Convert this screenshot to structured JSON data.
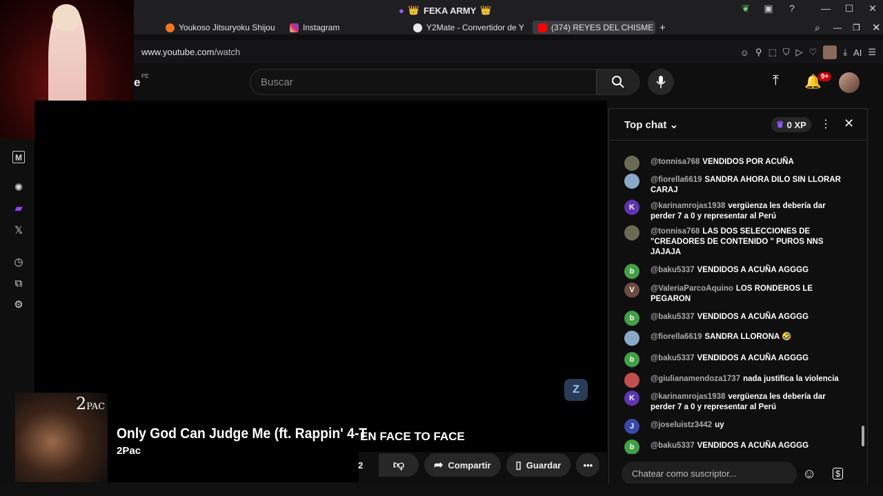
{
  "window": {
    "title": "FEKA ARMY",
    "title_prefix_icon": "crown-emoji",
    "controls": [
      "—",
      "☐",
      "✕"
    ]
  },
  "tabs": [
    {
      "label": "Youkoso Jitsuryoku Shijou",
      "favicon": "crunchyroll-icon",
      "color": "#f47521"
    },
    {
      "label": "Instagram",
      "favicon": "instagram-icon",
      "color": "#d6249f"
    },
    {
      "label": "Y2Mate - Convertidor de Y",
      "favicon": "y2mate-icon",
      "color": "#e8e8e8"
    },
    {
      "label": "(374) REYES DEL CHISME",
      "favicon": "youtube-icon",
      "color": "#ff0000",
      "active": true
    }
  ],
  "address": {
    "url_host": "www.youtube.com",
    "url_path": "/watch",
    "ai_label": "AI"
  },
  "youtube_header": {
    "logo_suffix": "PE",
    "logo_letter": "e",
    "search_placeholder": "Buscar",
    "notifications_badge": "9+"
  },
  "video": {
    "overlay_text": "EN FACE TO FACE",
    "watermark_text": "Z"
  },
  "now_playing": {
    "album_text": "2",
    "album_text_small": "PAC",
    "song_title": "Only God Can Judge Me (ft. Rappin' 4-T",
    "artist": "2Pac"
  },
  "actions": {
    "like_count": "2",
    "share_label": "Compartir",
    "save_label": "Guardar"
  },
  "chat": {
    "title": "Top chat",
    "xp_label": "0 XP",
    "input_placeholder": "Chatear como suscriptor...",
    "messages": [
      {
        "user": "@tonnisa768",
        "text": "VENDIDOS POR ACUÑA",
        "avatar": "",
        "avatar_color": "#6b6b55"
      },
      {
        "user": "@fiorella6619",
        "text": "SANDRA AHORA DILO SIN LLORAR CARAJ",
        "avatar": "",
        "avatar_color": "#8aa9c9"
      },
      {
        "user": "@karinamrojas1938",
        "text": "vergüenza les debería dar perder 7 a 0 y representar al Perú",
        "avatar": "K",
        "avatar_color": "#5e35b1"
      },
      {
        "user": "@tonnisa768",
        "text": "LAS DOS SELECCIONES DE \"CREADORES DE CONTENIDO \" PUROS NNS JAJAJA",
        "avatar": "",
        "avatar_color": "#6b6b55"
      },
      {
        "user": "@baku5337",
        "text": "VENDIDOS A ACUÑA AGGGG",
        "avatar": "b",
        "avatar_color": "#43a047"
      },
      {
        "user": "@ValeriaParcoAquino",
        "text": "LOS RONDEROS LE PEGARON",
        "avatar": "V",
        "avatar_color": "#6d4c41"
      },
      {
        "user": "@baku5337",
        "text": "VENDIDOS A ACUÑA AGGGG",
        "avatar": "b",
        "avatar_color": "#43a047"
      },
      {
        "user": "@fiorella6619",
        "text": "SANDRA LLORONA 🤣",
        "avatar": "",
        "avatar_color": "#8aa9c9"
      },
      {
        "user": "@baku5337",
        "text": "VENDIDOS A ACUÑA AGGGG",
        "avatar": "b",
        "avatar_color": "#43a047"
      },
      {
        "user": "@giulianamendoza1737",
        "text": "nada justifica la violencia",
        "avatar": "",
        "avatar_color": "#c0504d"
      },
      {
        "user": "@karinamrojas1938",
        "text": "vergüenza les debería dar perder 7 a 0 y representar al Perú",
        "avatar": "K",
        "avatar_color": "#5e35b1"
      },
      {
        "user": "@joseluistz3442",
        "text": "uy",
        "avatar": "J",
        "avatar_color": "#3949ab"
      },
      {
        "user": "@baku5337",
        "text": "VENDIDOS A ACUÑA AGGGG",
        "avatar": "b",
        "avatar_color": "#43a047"
      }
    ]
  }
}
